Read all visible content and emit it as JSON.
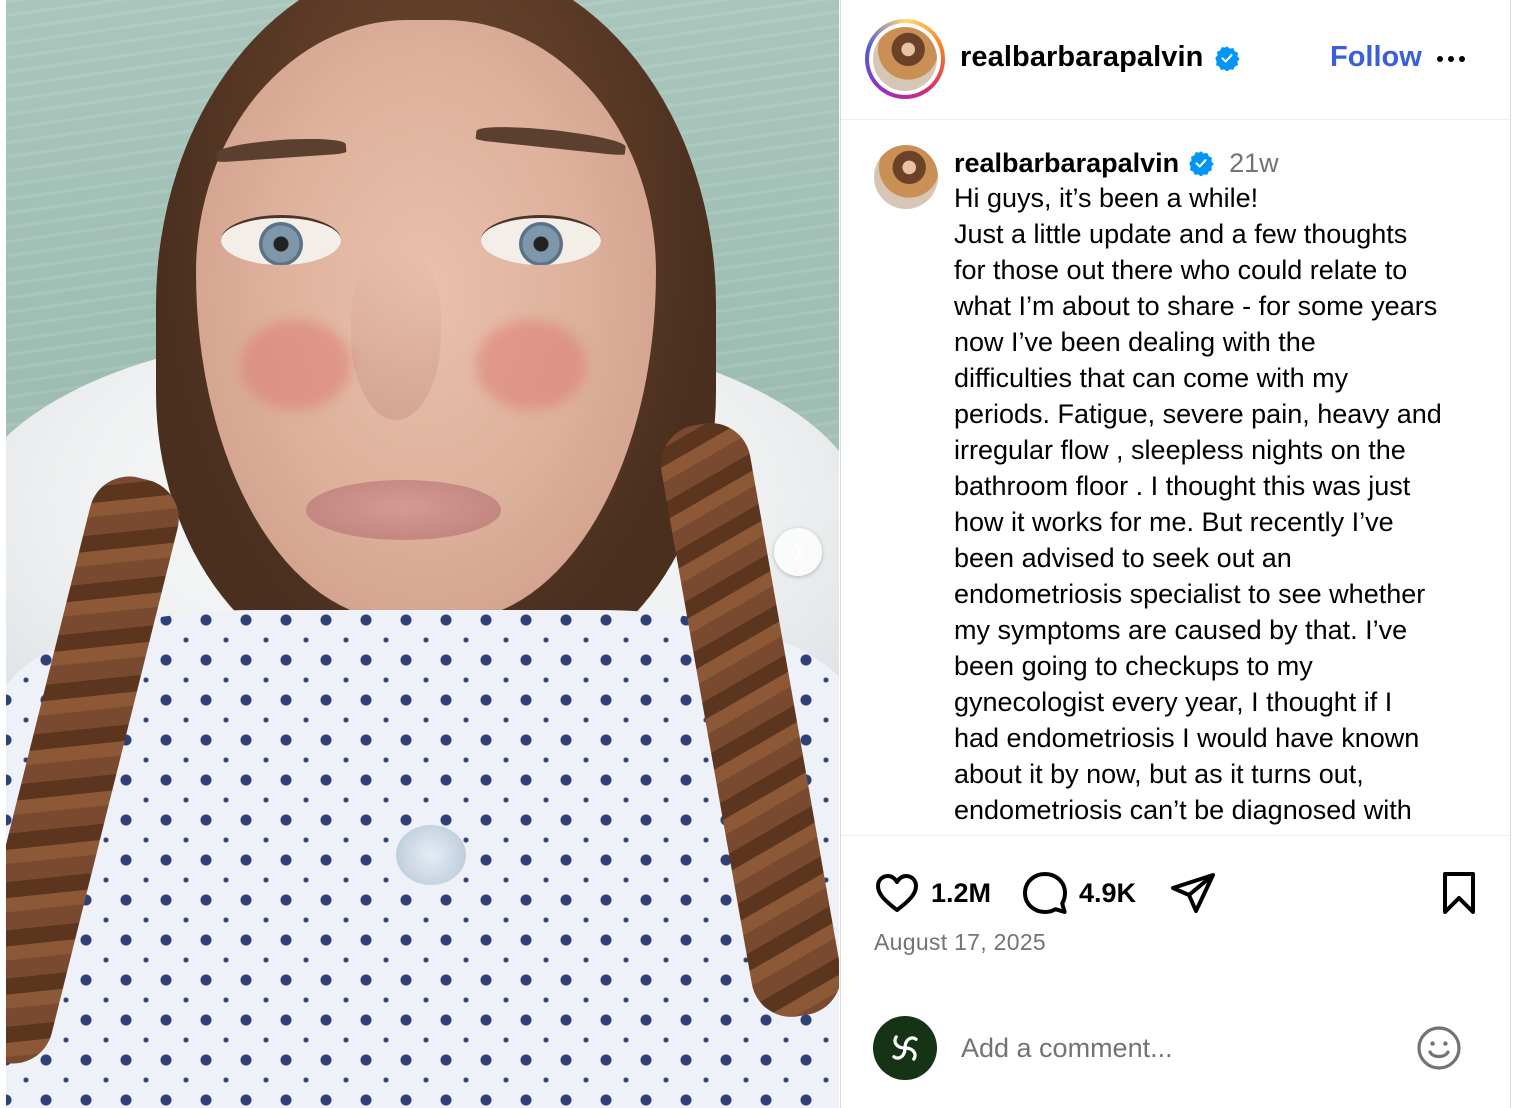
{
  "post": {
    "username": "realbarbarapalvin",
    "follow_label": "Follow",
    "time_ago": "21w",
    "caption_lines": [
      "Hi guys, it’s been a while!",
      "Just a little update and a few thoughts",
      "for those out there who could relate to",
      "what I’m about to share - for some years",
      "now I’ve been dealing with the",
      "difficulties that can come with my",
      "periods. Fatigue, severe pain, heavy and",
      "irregular flow , sleepless nights on the",
      "bathroom floor . I thought this was just",
      "how it works for me. But recently I’ve",
      "been advised to seek out an",
      "endometriosis specialist to see whether",
      "my symptoms are caused by that. I’ve",
      "been going to checkups to my",
      "gynecologist every year, I thought if I",
      "had endometriosis I would have known",
      "about it by now, but as it turns out,",
      "endometriosis can’t be diagnosed with"
    ],
    "likes": "1.2M",
    "comments": "4.9K",
    "date": "August 17, 2025"
  },
  "comment_box": {
    "placeholder": "Add a comment..."
  },
  "colors": {
    "follow_blue": "#3b5fd9",
    "verified_blue": "#0095f6",
    "muted_text": "#737373",
    "border": "#dbdbdb"
  },
  "icons": {
    "verified": "verified-badge-icon",
    "more": "more-options-icon",
    "like": "heart-icon",
    "comment": "comment-bubble-icon",
    "share": "paper-plane-icon",
    "save": "bookmark-icon",
    "emoji": "smiley-icon",
    "next": "chevron-right-icon"
  }
}
